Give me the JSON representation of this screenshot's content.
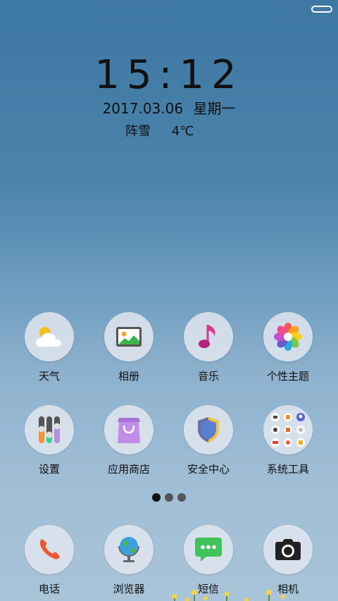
{
  "lockscreen": {
    "time": "15:12",
    "date": "2017.03.06",
    "weekday": "星期一",
    "weather": "阵雪",
    "temperature": "4℃"
  },
  "apps_row1": [
    {
      "label": "天气",
      "icon": "weather-icon"
    },
    {
      "label": "相册",
      "icon": "gallery-icon"
    },
    {
      "label": "音乐",
      "icon": "music-icon"
    },
    {
      "label": "个性主题",
      "icon": "themes-icon"
    }
  ],
  "apps_row2": [
    {
      "label": "设置",
      "icon": "settings-icon"
    },
    {
      "label": "应用商店",
      "icon": "app-store-icon"
    },
    {
      "label": "安全中心",
      "icon": "security-icon"
    },
    {
      "label": "系统工具",
      "icon": "system-tools-folder-icon"
    }
  ],
  "dock": [
    {
      "label": "电话",
      "icon": "phone-icon"
    },
    {
      "label": "浏览器",
      "icon": "browser-icon"
    },
    {
      "label": "短信",
      "icon": "messages-icon"
    },
    {
      "label": "相机",
      "icon": "camera-icon"
    }
  ],
  "page_indicator": {
    "pages": 3,
    "current": 1
  }
}
